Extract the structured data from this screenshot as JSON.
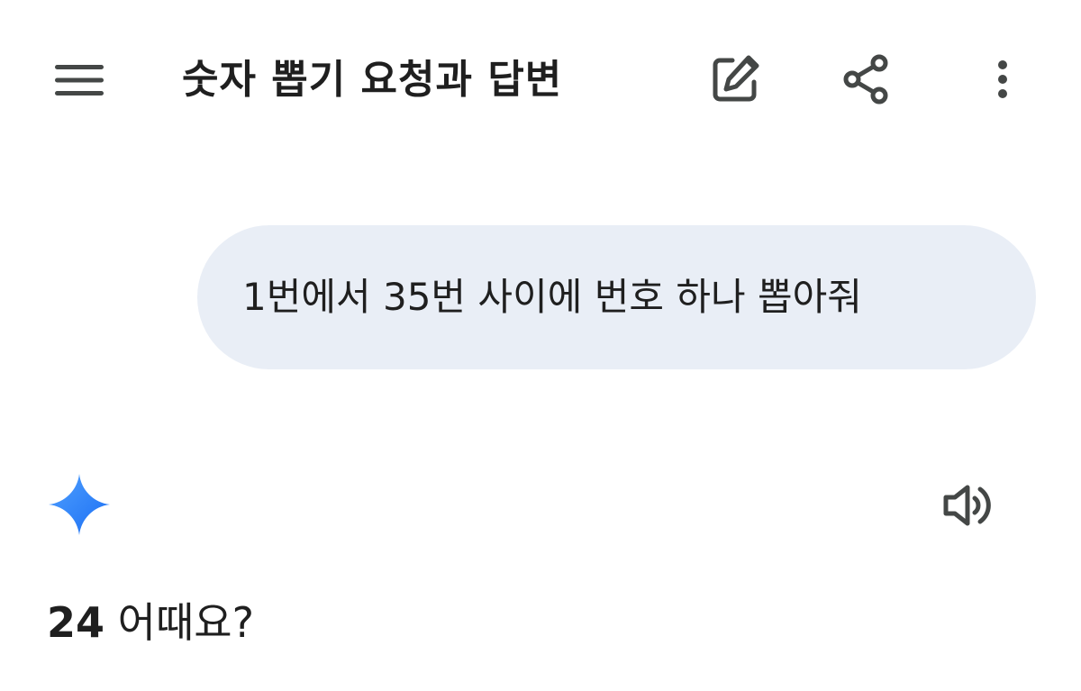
{
  "header": {
    "title": "숫자 뽑기 요청과 답변",
    "menu_icon": "hamburger-menu-icon",
    "edit_icon": "edit-new-chat-icon",
    "share_icon": "share-icon",
    "more_icon": "more-vertical-icon"
  },
  "conversation": {
    "user_message": "1번에서 35번 사이에 번호 하나 뽑아줘",
    "assistant_icon": "gemini-sparkle-icon",
    "speaker_icon": "speaker-volume-icon",
    "answer_number": "24",
    "answer_rest": " 어때요?"
  },
  "colors": {
    "user_bubble": "#e9eef6",
    "text": "#1f1f1f",
    "icon": "#444746",
    "sparkle_start": "#4285f4",
    "sparkle_end": "#1a73e8"
  }
}
